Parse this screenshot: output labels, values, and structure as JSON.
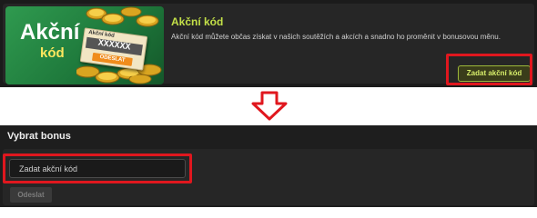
{
  "promo": {
    "banner_title": "Akční",
    "banner_subtitle": "kód",
    "ticket_title": "Akční kód",
    "ticket_code": "XXXXXX",
    "ticket_button": "ODESLAT",
    "title": "Akční kód",
    "description": "Akční kód můžete občas získat v našich soutěžích a akcích a snadno ho proměnit v bonusovou měnu.",
    "button_label": "Zadat akční kód"
  },
  "bonus": {
    "title": "Vybrat bonus",
    "input_placeholder": "Zadat akční kód",
    "submit_label": "Odeslat"
  },
  "colors": {
    "accent_green": "#c3e048",
    "highlight_red": "#e0171e",
    "ticket_orange": "#f08c1c"
  },
  "icons": {
    "transition": "arrow-down-icon"
  }
}
